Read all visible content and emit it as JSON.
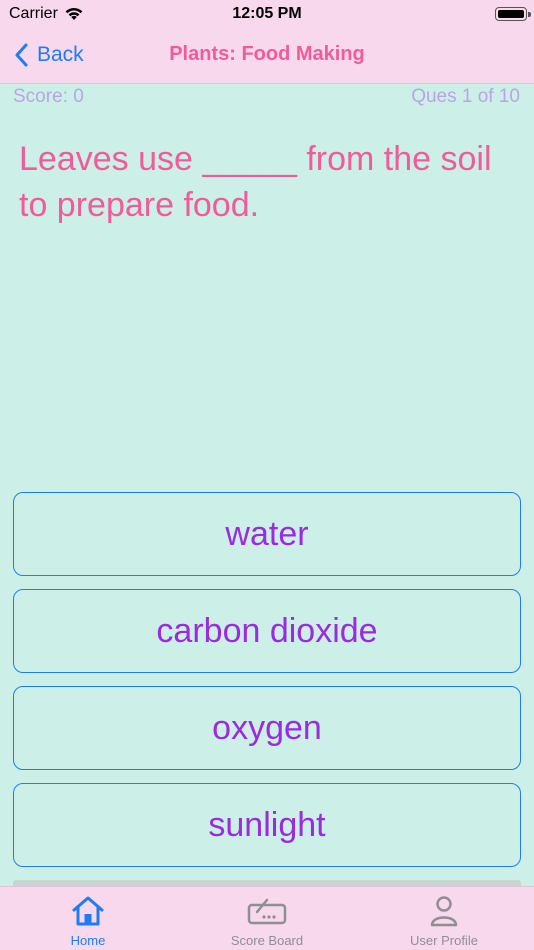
{
  "status_bar": {
    "carrier": "Carrier",
    "time": "12:05 PM"
  },
  "nav": {
    "back_label": "Back",
    "title": "Plants: Food Making"
  },
  "quiz": {
    "score": "Score: 0",
    "question_number": "Ques 1 of 10",
    "question": "Leaves use _____ from the soil to prepare food.",
    "options": [
      "water",
      "carbon dioxide",
      "oxygen",
      "sunlight"
    ]
  },
  "tabs": [
    {
      "label": "Home",
      "icon": "home-icon",
      "active": true
    },
    {
      "label": "Score Board",
      "icon": "scoreboard-icon",
      "active": false
    },
    {
      "label": "User Profile",
      "icon": "user-icon",
      "active": false
    }
  ],
  "colors": {
    "accent": "#1f7cf2",
    "title_pink": "#f25b9b",
    "option_text": "#9b2ae0",
    "background": "#ccf0e8",
    "bar_background": "#f7d8ec"
  }
}
